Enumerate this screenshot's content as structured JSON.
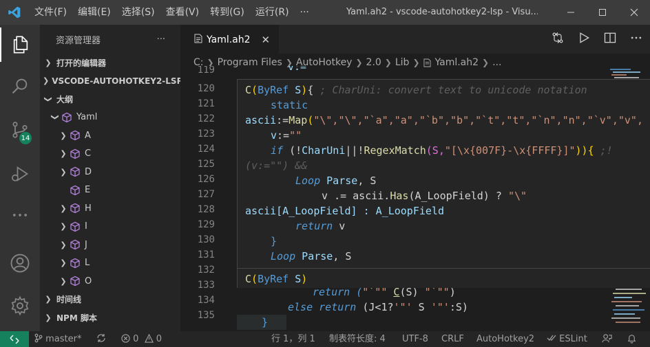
{
  "titlebar": {
    "menu": [
      "文件(F)",
      "编辑(E)",
      "选择(S)",
      "查看(V)",
      "转到(G)",
      "运行(R)",
      "···"
    ],
    "title": "Yaml.ah2 - vscode-autohotkey2-lsp - Visu..."
  },
  "activitybar": {
    "scm_badge": "14"
  },
  "sidebar": {
    "header": "资源管理器",
    "header_more": "···",
    "sections": {
      "open_editors": "打开的编辑器",
      "workspace": "VSCODE-AUTOHOTKEY2-LSP",
      "outline": "大纲",
      "timeline": "时间线",
      "npm": "NPM 脚本"
    },
    "outline_root": "Yaml",
    "outline_items": [
      "A",
      "C",
      "D",
      "E",
      "H",
      "I",
      "J",
      "L",
      "O"
    ]
  },
  "tab": {
    "label": "Yaml.ah2",
    "close": "✕"
  },
  "breadcrumb": [
    "C:",
    "Program Files",
    "AutoHotkey",
    "2.0",
    "Lib",
    "Yaml.ah2",
    "..."
  ],
  "line_numbers": [
    "119",
    "120",
    "121",
    "122",
    "123",
    "124",
    "125",
    "126",
    "127",
    "128",
    "129",
    "130",
    "131",
    "132",
    "133",
    "134",
    "135"
  ],
  "code": {
    "l119": "v:=",
    "l133_a": "return (",
    "l133_b": "\"`\"\" ",
    "l133_c": "C",
    "l133_d": "(S) ",
    "l133_e": "\"`\"\"",
    "l133_f": ")",
    "l134_a": "else return",
    "l134_b": " (J<1?",
    "l134_c": "'\"'",
    "l134_d": " S ",
    "l134_e": "'\"'",
    "l134_f": ":S)",
    "l135": "}"
  },
  "hover": {
    "sig1_name": "C",
    "sig1_paren_open": "(",
    "sig1_byref": "ByRef",
    "sig1_param": " S",
    "sig1_paren_close": ")",
    "sig1_brace": "{ ",
    "sig1_comment": "; CharUni: convert text to unicode notation",
    "line2": "static",
    "line3_a": "ascii",
    "line3_b": ":=",
    "line3_c": "Map",
    "line3_d": "(",
    "line3_e": "\"\\\",\"\\\",\"`a\",\"a\",\"`b\",\"b\",\"`t\",\"t\",\"`n\",\"n\",\"`v\",\"v\",",
    "line4_a": "v",
    "line4_b": ":=",
    "line4_c": "\"\"",
    "line5_a": "if",
    "line5_b": " (!",
    "line5_c": "CharUni",
    "line5_d": "||!",
    "line5_e": "RegexMatch",
    "line5_f": "(S,",
    "line5_g": "\"[\\x{007F}-\\x{FFFF}]\"",
    "line5_h": ")){ ",
    "line5_i": ";!",
    "line6": "(v:=\"\") &&",
    "line7_a": "Loop",
    "line7_b": " Parse",
    "line7_c": ", S",
    "line8_a": "v ",
    "line8_b": ".=",
    "line8_c": " ascii.",
    "line8_d": "Has",
    "line8_e": "(A_LoopField) ? ",
    "line8_f": "\"\\\"",
    "line9_a": "ascii",
    "line9_b": "[A_LoopField]",
    "line9_c": " : A_LoopField",
    "line10_a": "return",
    "line10_b": " v",
    "line11": "}",
    "line12_a": "Loop",
    "line12_b": " Parse",
    "line12_c": ", S",
    "sig2_name": "C",
    "sig2_paren_open": "(",
    "sig2_byref": "ByRef",
    "sig2_param": " S",
    "sig2_paren_close": ")"
  },
  "statusbar": {
    "branch": "master*",
    "errors": "0",
    "warnings": "0",
    "position": "行 1，列 1",
    "tab_size": "制表符长度: 4",
    "encoding": "UTF-8",
    "eol": "CRLF",
    "language": "AutoHotkey2",
    "linter": "ESLint"
  },
  "colors": {
    "accent": "#16825d",
    "keyword": "#569cd6",
    "function": "#dcdcaa",
    "string": "#ce9178",
    "comment": "#6a9955"
  }
}
